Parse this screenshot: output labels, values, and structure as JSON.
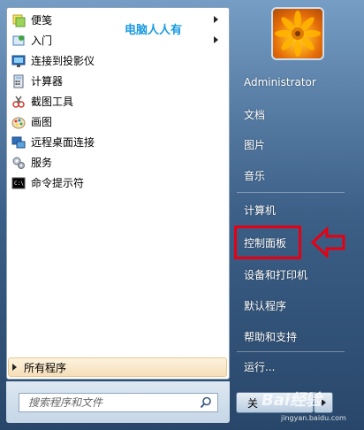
{
  "programs": [
    {
      "label": "便笺",
      "icon": "sticky-notes-icon",
      "submenu": true
    },
    {
      "label": "入门",
      "icon": "getting-started-icon",
      "submenu": true
    },
    {
      "label": "连接到投影仪",
      "icon": "projector-icon",
      "submenu": false
    },
    {
      "label": "计算器",
      "icon": "calculator-icon",
      "submenu": false
    },
    {
      "label": "截图工具",
      "icon": "snipping-tool-icon",
      "submenu": false
    },
    {
      "label": "画图",
      "icon": "paint-icon",
      "submenu": false
    },
    {
      "label": "远程桌面连接",
      "icon": "remote-desktop-icon",
      "submenu": false
    },
    {
      "label": "服务",
      "icon": "services-icon",
      "submenu": false
    },
    {
      "label": "命令提示符",
      "icon": "command-prompt-icon",
      "submenu": false
    }
  ],
  "watermark_text": "电脑人人有",
  "all_programs": "所有程序",
  "search": {
    "placeholder": "搜索程序和文件"
  },
  "user": {
    "name": "Administrator"
  },
  "right_items": {
    "documents": "文档",
    "pictures": "图片",
    "music": "音乐",
    "computer": "计算机",
    "control_panel": "控制面板",
    "devices_printers": "设备和打印机",
    "default_programs": "默认程序",
    "help_support": "帮助和支持",
    "run": "运行..."
  },
  "shutdown_label": "关",
  "baidu": {
    "mark": "Bai经验",
    "url": "jingyan.baidu.com"
  },
  "colors": {
    "highlight": "#e60012",
    "watermark": "#1a9ae0",
    "all_programs_bg": "#f6dfb8"
  }
}
